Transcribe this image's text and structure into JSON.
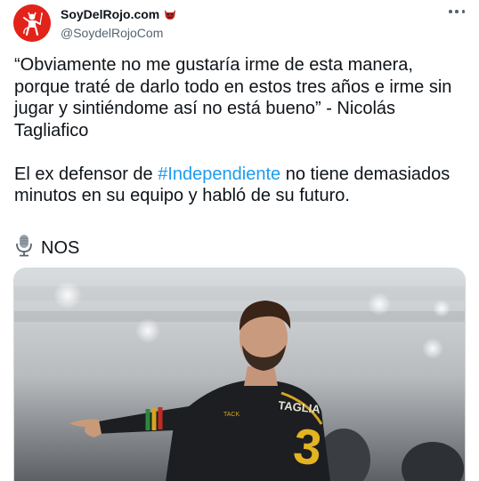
{
  "author": {
    "display_name": "SoyDelRojo.com",
    "handle": "@SoydelRojoCom",
    "avatar_icon": "devil-logo-icon",
    "badge_icon": "devil-face-emoji-icon",
    "brand_color": "#e2231a"
  },
  "tweet": {
    "quote_text": "“Obviamente no me gustaría irme de esta manera, porque traté de darlo todo en estos tres años e irme sin jugar y sintiéndome así no está bueno” - Nicolás Tagliafico",
    "body_prefix": "El ex defensor de ",
    "hashtag": "#Independiente",
    "body_suffix": " no tiene demasiados minutos en su equipo y habló de su futuro.",
    "source_icon": "microphone-icon",
    "source_label": "NOS",
    "hashtag_color": "#1d9bf0"
  },
  "media": {
    "description_icon": "player-photo",
    "jersey_number": "3",
    "jersey_name": "TAGLIAFICO"
  },
  "more_icon": "more-options-icon"
}
